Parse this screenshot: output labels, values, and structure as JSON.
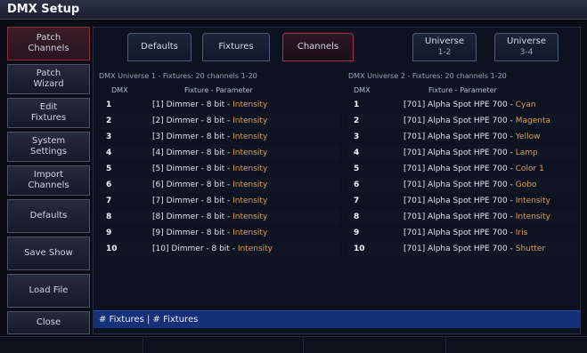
{
  "window": {
    "title": "DMX Setup"
  },
  "sidebar": {
    "items": [
      {
        "label": "Patch\nChannels",
        "active": true
      },
      {
        "label": "Patch\nWizard"
      },
      {
        "label": "Edit\nFixtures"
      },
      {
        "label": "System\nSettings"
      },
      {
        "label": "Import\nChannels"
      },
      {
        "label": "Defaults"
      },
      {
        "label": "Save Show"
      },
      {
        "label": "Load File"
      },
      {
        "label": "Close"
      }
    ]
  },
  "tabs": [
    {
      "label": "Defaults"
    },
    {
      "label": "Fixtures"
    },
    {
      "label": "Channels",
      "active": true
    },
    {
      "label": "Universe",
      "sub": "1-2"
    },
    {
      "label": "Universe",
      "sub": "3-4"
    }
  ],
  "left_panel": {
    "header": "DMX Universe 1 - Fixtures: 20 channels 1-20",
    "columns": [
      "DMX",
      "Fixture - Parameter"
    ],
    "rows": [
      {
        "dmx": "1",
        "fixture": "[1] Dimmer - 8 bit - ",
        "param": "Intensity"
      },
      {
        "dmx": "2",
        "fixture": "[2] Dimmer - 8 bit - ",
        "param": "Intensity"
      },
      {
        "dmx": "3",
        "fixture": "[3] Dimmer - 8 bit - ",
        "param": "Intensity"
      },
      {
        "dmx": "4",
        "fixture": "[4] Dimmer - 8 bit - ",
        "param": "Intensity"
      },
      {
        "dmx": "5",
        "fixture": "[5] Dimmer - 8 bit - ",
        "param": "Intensity"
      },
      {
        "dmx": "6",
        "fixture": "[6] Dimmer - 8 bit - ",
        "param": "Intensity"
      },
      {
        "dmx": "7",
        "fixture": "[7] Dimmer - 8 bit - ",
        "param": "Intensity"
      },
      {
        "dmx": "8",
        "fixture": "[8] Dimmer - 8 bit - ",
        "param": "Intensity"
      },
      {
        "dmx": "9",
        "fixture": "[9] Dimmer - 8 bit - ",
        "param": "Intensity"
      },
      {
        "dmx": "10",
        "fixture": "[10] Dimmer - 8 bit - ",
        "param": "Intensity"
      }
    ]
  },
  "right_panel": {
    "header": "DMX Universe 2 - Fixtures: 20 channels 1-20",
    "columns": [
      "DMX",
      "Fixture - Parameter"
    ],
    "rows": [
      {
        "dmx": "1",
        "fixture": "[701] Alpha Spot HPE 700 - ",
        "param": "Cyan"
      },
      {
        "dmx": "2",
        "fixture": "[701] Alpha Spot HPE 700 - ",
        "param": "Magenta"
      },
      {
        "dmx": "3",
        "fixture": "[701] Alpha Spot HPE 700 - ",
        "param": "Yellow"
      },
      {
        "dmx": "4",
        "fixture": "[701] Alpha Spot HPE 700 - ",
        "param": "Lamp"
      },
      {
        "dmx": "5",
        "fixture": "[701] Alpha Spot HPE 700 - ",
        "param": "Color 1"
      },
      {
        "dmx": "6",
        "fixture": "[701] Alpha Spot HPE 700 - ",
        "param": "Gobo"
      },
      {
        "dmx": "7",
        "fixture": "[701] Alpha Spot HPE 700 - ",
        "param": "Intensity"
      },
      {
        "dmx": "8",
        "fixture": "[701] Alpha Spot HPE 700 - ",
        "param": "Intensity"
      },
      {
        "dmx": "9",
        "fixture": "[701] Alpha Spot HPE 700 - ",
        "param": "Iris"
      },
      {
        "dmx": "10",
        "fixture": "[701] Alpha Spot HPE 700 - ",
        "param": "Shutter"
      }
    ]
  },
  "status": {
    "text": "# Fixtures | # Fixtures"
  },
  "colors": {
    "accent_red": "#a0354a",
    "param_orange": "#d9a15b",
    "status_blue": "#17307a"
  }
}
